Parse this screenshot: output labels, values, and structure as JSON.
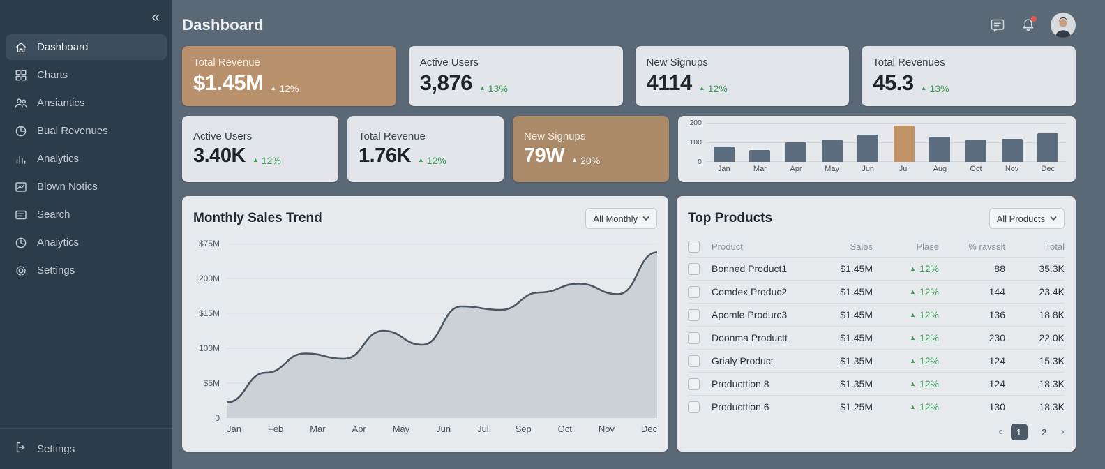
{
  "colors": {
    "sidebar_bg": "#2d3c49",
    "sidebar_active_bg": "#3d4d5c",
    "main_bg": "#5b6977",
    "card_bg": "#e2e5e9",
    "accent_tan": "#b8906c",
    "accent_tan_dark": "#ab8a6a",
    "positive_green": "#3d9d57",
    "bar_slate": "#5c6d80",
    "bar_highlight_tan": "#c09467",
    "trend_line": "#4b5763",
    "trend_fill": "#c9ced5",
    "notification_red": "#e0594b",
    "pagination_active_bg": "#4d5966"
  },
  "sidebar": {
    "collapse_glyph": "«",
    "items": [
      {
        "label": "Dashboard",
        "icon": "home-icon",
        "active": true
      },
      {
        "label": "Charts",
        "icon": "grid-icon",
        "active": false
      },
      {
        "label": "Ansiantics",
        "icon": "users-icon",
        "active": false
      },
      {
        "label": "Bual Revenues",
        "icon": "pie-chart-icon",
        "active": false
      },
      {
        "label": "Analytics",
        "icon": "bar-chart-icon",
        "active": false
      },
      {
        "label": "Blown Notics",
        "icon": "line-chart-icon",
        "active": false
      },
      {
        "label": "Search",
        "icon": "list-icon",
        "active": false
      },
      {
        "label": "Analytics",
        "icon": "clock-icon",
        "active": false
      },
      {
        "label": "Settings",
        "icon": "gear-icon",
        "active": false
      }
    ],
    "footer_item": {
      "label": "Settings",
      "icon": "logout-icon"
    }
  },
  "header": {
    "title": "Dashboard",
    "bell_has_badge": true
  },
  "stat_cards_row1": [
    {
      "label": "Total Revenue",
      "value": "$1.45M",
      "delta": "12%",
      "trend": "up",
      "variant": "tan"
    },
    {
      "label": "Active Users",
      "value": "3,876",
      "delta": "13%",
      "trend": "up",
      "variant": "light"
    },
    {
      "label": "New Signups",
      "value": "4114",
      "delta": "12%",
      "trend": "up",
      "variant": "light"
    },
    {
      "label": "Total Revenues",
      "value": "45.3",
      "delta": "13%",
      "trend": "up",
      "variant": "light"
    }
  ],
  "stat_cards_row2": [
    {
      "label": "Active Users",
      "value": "3.40K",
      "delta": "12%",
      "trend": "up",
      "variant": "light"
    },
    {
      "label": "Total Revenue",
      "value": "1.76K",
      "delta": "12%",
      "trend": "up",
      "variant": "light"
    },
    {
      "label": "New Signups",
      "value": "79W",
      "delta": "20%",
      "trend": "up",
      "variant": "tan"
    }
  ],
  "panels": {
    "sales_trend": {
      "title": "Monthly Sales Trend",
      "filter_label": "All Monthly"
    },
    "top_products": {
      "title": "Top Products",
      "filter_label": "All Products"
    }
  },
  "top_products_table": {
    "columns": [
      "Product",
      "Sales",
      "Plase",
      "% ravssit",
      "Total"
    ],
    "rows": [
      {
        "product": "Bonned Product1",
        "sales": "$1.45M",
        "plase": "12%",
        "pct": "88",
        "total": "35.3K"
      },
      {
        "product": "Comdex Produc2",
        "sales": "$1.45M",
        "plase": "12%",
        "pct": "144",
        "total": "23.4K"
      },
      {
        "product": "Apomle Produrc3",
        "sales": "$1.45M",
        "plase": "12%",
        "pct": "136",
        "total": "18.8K"
      },
      {
        "product": "Doonma Productt",
        "sales": "$1.45M",
        "plase": "12%",
        "pct": "230",
        "total": "22.0K"
      },
      {
        "product": "Grialy Product",
        "sales": "$1.35M",
        "plase": "12%",
        "pct": "124",
        "total": "15.3K"
      },
      {
        "product": "Producttion 8",
        "sales": "$1.35M",
        "plase": "12%",
        "pct": "124",
        "total": "18.3K"
      },
      {
        "product": "Producttion 6",
        "sales": "$1.25M",
        "plase": "12%",
        "pct": "130",
        "total": "18.3K"
      }
    ],
    "pagination": {
      "prev": "‹",
      "pages": [
        "1",
        "2"
      ],
      "active_page": "1",
      "next": "›"
    }
  },
  "chart_data": [
    {
      "id": "monthly-mini-bars",
      "type": "bar",
      "categories": [
        "Jan",
        "Mar",
        "Apr",
        "May",
        "Jun",
        "Jul",
        "Aug",
        "Oct",
        "Nov",
        "Dec"
      ],
      "values": [
        80,
        60,
        103,
        115,
        140,
        190,
        130,
        115,
        120,
        150
      ],
      "highlight_index": 5,
      "ylim": [
        0,
        200
      ],
      "ytick_labels": [
        "200",
        "100",
        "0"
      ],
      "grid": true,
      "bar_color": "#5c6d80",
      "highlight_color": "#c09467"
    },
    {
      "id": "sales-trend-area",
      "type": "area",
      "title": "Monthly Sales Trend",
      "x": [
        "Jan",
        "Feb",
        "Mar",
        "Apr",
        "May",
        "Jun",
        "Jul",
        "Aug",
        "Sep",
        "Oct",
        "Nov",
        "Dec"
      ],
      "x_tick_labels": [
        "Jan",
        "Feb",
        "Mar",
        "Apr",
        "May",
        "Jun",
        "Jul",
        "Sep",
        "Oct",
        "Nov",
        "Dec"
      ],
      "y_tick_labels_top_to_bottom": [
        "$75M",
        "200M",
        "$15M",
        "100M",
        "$5M",
        "0"
      ],
      "values_pct_of_plot_height": [
        9,
        26,
        37,
        34,
        50,
        42,
        64,
        62,
        72,
        77,
        71,
        95
      ],
      "grid": true,
      "line_color": "#4b5763",
      "fill_color": "#c9ced5"
    }
  ]
}
